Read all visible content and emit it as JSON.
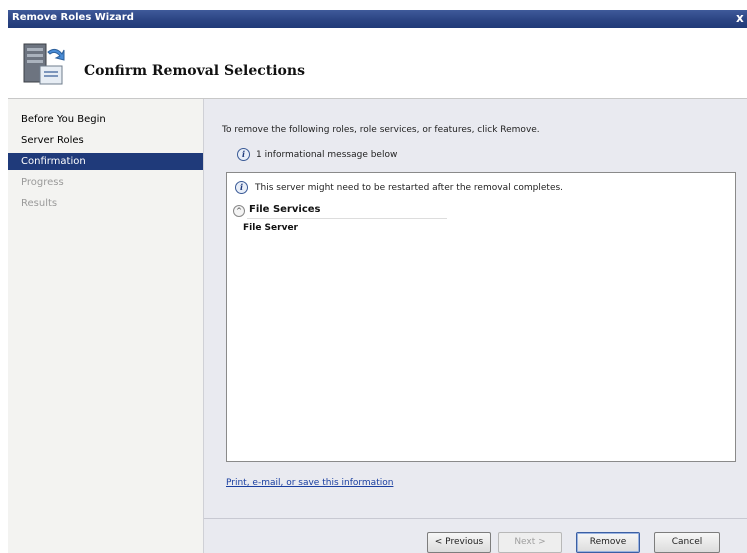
{
  "window": {
    "title": "Remove Roles Wizard",
    "close_glyph": "x"
  },
  "header": {
    "icon": "server-remove-icon",
    "title": "Confirm Removal Selections"
  },
  "nav": {
    "items": [
      {
        "label": "Before You Begin",
        "state": "normal"
      },
      {
        "label": "Server Roles",
        "state": "normal"
      },
      {
        "label": "Confirmation",
        "state": "active"
      },
      {
        "label": "Progress",
        "state": "disabled"
      },
      {
        "label": "Results",
        "state": "disabled"
      }
    ]
  },
  "main": {
    "instruction": "To remove the following roles, role services, or features, click Remove.",
    "info_message": "1 informational message below",
    "results": {
      "restart_message": "This server might need to be restarted after the removal completes.",
      "section_title": "File Services",
      "items": [
        "File Server"
      ]
    },
    "link": "Print, e-mail, or save this information"
  },
  "buttons": {
    "previous": "< Previous",
    "next": "Next >",
    "remove": "Remove",
    "cancel": "Cancel"
  },
  "colors": {
    "title_bar": "#2b4483",
    "nav_active": "#1f3a7a",
    "link": "#1a3fa0"
  }
}
